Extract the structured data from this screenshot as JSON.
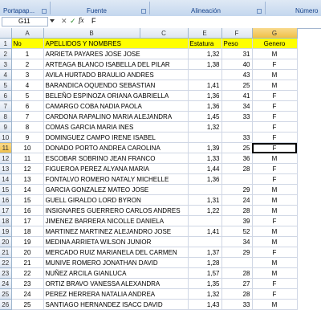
{
  "ribbon": {
    "groups": [
      "Portapap...",
      "Fuente",
      "Alineación",
      "Número"
    ]
  },
  "formula_bar": {
    "name_box": "G11",
    "fx_cancel": "✕",
    "fx_enter": "✓",
    "fx": "fx",
    "value": "F"
  },
  "columns": [
    "A",
    "B",
    "C",
    "E",
    "F",
    "G"
  ],
  "header_row": {
    "row": "1",
    "no": "No",
    "name": "APELLIDOS Y NOMBRES",
    "estatura": "Estatura",
    "peso": "Peso",
    "genero": "Genero"
  },
  "rows": [
    {
      "row": "2",
      "no": "1",
      "name": "ARRIETA PAYARES JOSE JOSE",
      "estatura": "1,32",
      "peso": "31",
      "genero": "M"
    },
    {
      "row": "3",
      "no": "2",
      "name": "ARTEAGA BLANCO ISABELLA DEL PILAR",
      "estatura": "1,38",
      "peso": "40",
      "genero": "F"
    },
    {
      "row": "4",
      "no": "3",
      "name": "AVILA HURTADO  BRAULIO ANDRES",
      "estatura": "",
      "peso": "43",
      "genero": "M"
    },
    {
      "row": "5",
      "no": "4",
      "name": "BARANDICA OQUENDO SEBASTIAN",
      "estatura": "1,41",
      "peso": "25",
      "genero": "M"
    },
    {
      "row": "6",
      "no": "5",
      "name": "BELEÑO ESPINOZA ORIANA GABRIELLA",
      "estatura": "1,36",
      "peso": "41",
      "genero": "F"
    },
    {
      "row": "7",
      "no": "6",
      "name": "CAMARGO COBA NADIA PAOLA",
      "estatura": "1,36",
      "peso": "34",
      "genero": "F"
    },
    {
      "row": "8",
      "no": "7",
      "name": "CARDONA RAPALINO MARIA ALEJANDRA",
      "estatura": "1,45",
      "peso": "33",
      "genero": "F"
    },
    {
      "row": "9",
      "no": "8",
      "name": "COMAS GARCIA MARIA INES",
      "estatura": "1,32",
      "peso": "",
      "genero": "F"
    },
    {
      "row": "10",
      "no": "9",
      "name": "DOMINGUEZ CAMPO  IRENE ISABEL",
      "estatura": "",
      "peso": "33",
      "genero": "F"
    },
    {
      "row": "11",
      "no": "10",
      "name": "DONADO PORTO ANDREA CAROLINA",
      "estatura": "1,39",
      "peso": "25",
      "genero": "F"
    },
    {
      "row": "12",
      "no": "11",
      "name": "ESCOBAR SOBRINO JEAN FRANCO",
      "estatura": "1,33",
      "peso": "36",
      "genero": "M"
    },
    {
      "row": "13",
      "no": "12",
      "name": "FIGUEROA PEREZ ALYANA MARIA",
      "estatura": "1,44",
      "peso": "28",
      "genero": "F"
    },
    {
      "row": "14",
      "no": "13",
      "name": "FONTALVO ROMERO NATALY MICHELLE",
      "estatura": "1,36",
      "peso": "",
      "genero": "F"
    },
    {
      "row": "15",
      "no": "14",
      "name": "GARCIA GONZALEZ  MATEO JOSE",
      "estatura": "",
      "peso": "29",
      "genero": "M"
    },
    {
      "row": "16",
      "no": "15",
      "name": "GUELL GIRALDO LORD BYRON",
      "estatura": "1,31",
      "peso": "24",
      "genero": "M"
    },
    {
      "row": "17",
      "no": "16",
      "name": "INSIGNARES GUERRERO CARLOS ANDRES",
      "estatura": "1,22",
      "peso": "28",
      "genero": "M"
    },
    {
      "row": "18",
      "no": "17",
      "name": "JIMENEZ BARRERA NICOLLE DANIELA",
      "estatura": "",
      "peso": "39",
      "genero": "F"
    },
    {
      "row": "19",
      "no": "18",
      "name": "MARTINEZ MARTINEZ ALEJANDRO JOSE",
      "estatura": "1,41",
      "peso": "52",
      "genero": "M"
    },
    {
      "row": "20",
      "no": "19",
      "name": "MEDINA ARRIETA  WILSON JUNIOR",
      "estatura": "",
      "peso": "34",
      "genero": "M"
    },
    {
      "row": "21",
      "no": "20",
      "name": "MERCADO RUIZ MARIANELA DEL CARMEN",
      "estatura": "1,37",
      "peso": "29",
      "genero": "F"
    },
    {
      "row": "22",
      "no": "21",
      "name": "MUNIVE ROMERO JONATHAN DAVID",
      "estatura": "1,28",
      "peso": "",
      "genero": "M"
    },
    {
      "row": "23",
      "no": "22",
      "name": "NUÑEZ ARCILA GIANLUCA",
      "estatura": "1,57",
      "peso": "28",
      "genero": "M"
    },
    {
      "row": "24",
      "no": "23",
      "name": "ORTIZ BRAVO VANESSA ALEXANDRA",
      "estatura": "1,35",
      "peso": "27",
      "genero": "F"
    },
    {
      "row": "25",
      "no": "24",
      "name": "PEREZ HERRERA NATALIA ANDREA",
      "estatura": "1,32",
      "peso": "28",
      "genero": "F"
    },
    {
      "row": "26",
      "no": "25",
      "name": "SANTIAGO HERNANDEZ ISACC DAVID",
      "estatura": "1,43",
      "peso": "33",
      "genero": "M"
    }
  ]
}
